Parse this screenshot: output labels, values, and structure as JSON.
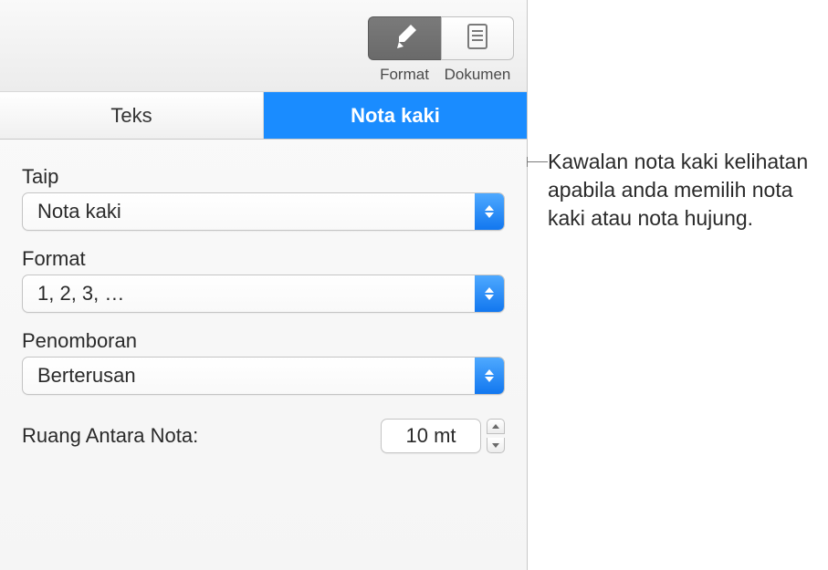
{
  "toolbar": {
    "format_label": "Format",
    "document_label": "Dokumen"
  },
  "tabs": {
    "text_label": "Teks",
    "footnotes_label": "Nota kaki"
  },
  "fields": {
    "type": {
      "label": "Taip",
      "value": "Nota kaki"
    },
    "format": {
      "label": "Format",
      "value": "1, 2, 3, …"
    },
    "numbering": {
      "label": "Penomboran",
      "value": "Berterusan"
    },
    "spacing": {
      "label": "Ruang Antara Nota:",
      "value": "10 mt"
    }
  },
  "callout": {
    "text": "Kawalan nota kaki kelihatan apabila anda memilih nota kaki atau nota hujung."
  }
}
